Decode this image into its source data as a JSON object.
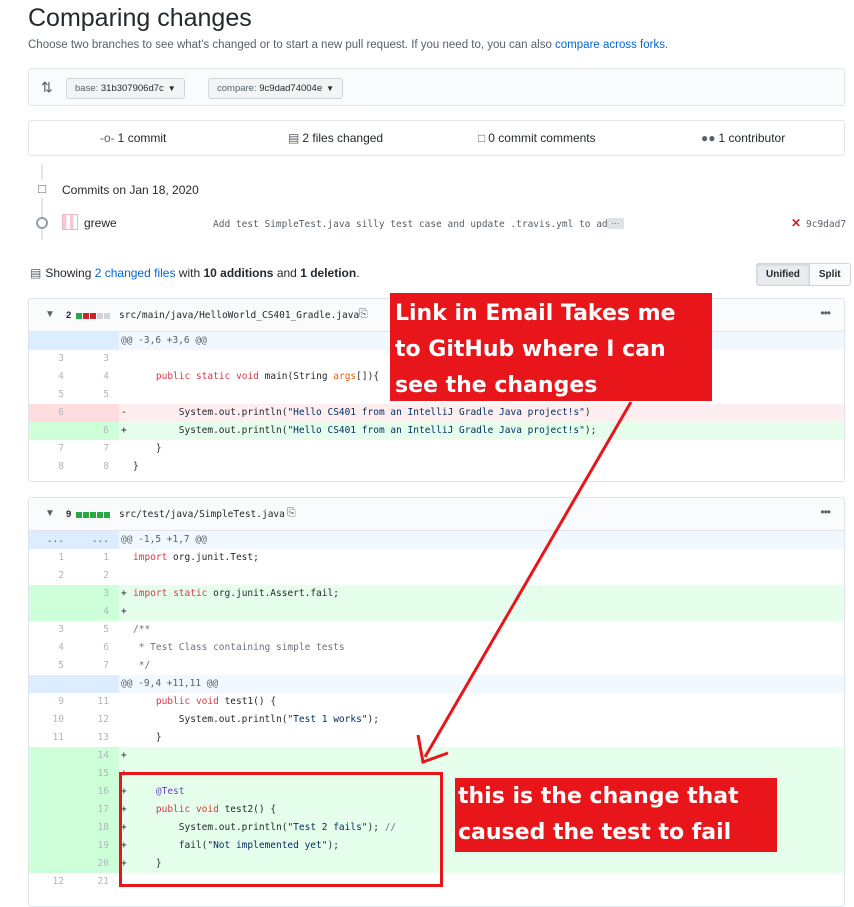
{
  "header": {
    "title": "Comparing changes",
    "subtitle_text": "Choose two branches to see what's changed or to start a new pull request. If you need to, you can also ",
    "subtitle_link": "compare across forks",
    "subtitle_end": "."
  },
  "range": {
    "base_label": "base:",
    "base_value": "31b307906d7c",
    "compare_label": "compare:",
    "compare_value": "9c9dad74004e"
  },
  "summary": {
    "commits": "1",
    "commits_label": "commit",
    "files": "2",
    "files_label": "files changed",
    "comments": "0",
    "comments_label": "commit comments",
    "contributors": "1",
    "contributors_label": "contributor"
  },
  "commits": {
    "date_heading": "Commits on Jan 18, 2020",
    "items": [
      {
        "author": "grewe",
        "message": "Add test SimpleTest.java silly test case and update .travis.yml to ad…",
        "ellipsis": "…",
        "sha": "9c9dad7",
        "status": "failed"
      }
    ]
  },
  "files_summary": {
    "prefix": "Showing ",
    "link": "2 changed files",
    "middle": " with ",
    "additions": "10 additions",
    "and": " and ",
    "deletions": "1 deletion",
    "suffix": "."
  },
  "view_toggle": {
    "unified": "Unified",
    "split": "Split"
  },
  "files": [
    {
      "count": "2",
      "path": "src/main/java/HelloWorld_CS401_Gradle.java",
      "hunk": "@@ -3,6 +3,6 @@",
      "lines": [
        {
          "old": "3",
          "new": "3",
          "sign": " ",
          "text": ""
        },
        {
          "old": "4",
          "new": "4",
          "sign": " ",
          "text": "    public static void main(String args[]){"
        },
        {
          "old": "5",
          "new": "5",
          "sign": " ",
          "text": ""
        },
        {
          "old": "6",
          "new": "",
          "sign": "-",
          "text": "        System.out.println(\"Hello CS401 from an IntelliJ Gradle Java project!s\")"
        },
        {
          "old": "",
          "new": "6",
          "sign": "+",
          "text": "        System.out.println(\"Hello CS401 from an IntelliJ Gradle Java project!s\");"
        },
        {
          "old": "7",
          "new": "7",
          "sign": " ",
          "text": "    }"
        },
        {
          "old": "8",
          "new": "8",
          "sign": " ",
          "text": "}"
        }
      ]
    },
    {
      "count": "9",
      "path": "src/test/java/SimpleTest.java",
      "hunk1": "@@ -1,5 +1,7 @@",
      "hunk1_num": "...",
      "hunk2": "@@ -9,4 +11,11 @@",
      "lines_a": [
        {
          "old": "1",
          "new": "1",
          "sign": " ",
          "text": "import org.junit.Test;"
        },
        {
          "old": "2",
          "new": "2",
          "sign": " ",
          "text": ""
        },
        {
          "old": "",
          "new": "3",
          "sign": "+",
          "text": "import static org.junit.Assert.fail;"
        },
        {
          "old": "",
          "new": "4",
          "sign": "+",
          "text": ""
        },
        {
          "old": "3",
          "new": "5",
          "sign": " ",
          "text": "/**"
        },
        {
          "old": "4",
          "new": "6",
          "sign": " ",
          "text": " * Test Class containing simple tests"
        },
        {
          "old": "5",
          "new": "7",
          "sign": " ",
          "text": " */"
        }
      ],
      "lines_b": [
        {
          "old": "9",
          "new": "11",
          "sign": " ",
          "text": "    public void test1() {"
        },
        {
          "old": "10",
          "new": "12",
          "sign": " ",
          "text": "        System.out.println(\"Test 1 works\");"
        },
        {
          "old": "11",
          "new": "13",
          "sign": " ",
          "text": "    }"
        },
        {
          "old": "",
          "new": "14",
          "sign": "+",
          "text": ""
        },
        {
          "old": "",
          "new": "15",
          "sign": "+",
          "text": ""
        },
        {
          "old": "",
          "new": "16",
          "sign": "+",
          "text": "    @Test"
        },
        {
          "old": "",
          "new": "17",
          "sign": "+",
          "text": "    public void test2() {"
        },
        {
          "old": "",
          "new": "18",
          "sign": "+",
          "text": "        System.out.println(\"Test 2 fails\"); //"
        },
        {
          "old": "",
          "new": "19",
          "sign": "+",
          "text": "        fail(\"Not implemented yet\");"
        },
        {
          "old": "",
          "new": "20",
          "sign": "+",
          "text": "    }"
        },
        {
          "old": "12",
          "new": "21",
          "sign": " ",
          "text": ""
        }
      ]
    }
  ],
  "annotations": {
    "callout_1": "Link in Email Takes me to GitHub where I can see the changes",
    "callout_2": "this is the change that caused the test to fail",
    "color": "#e8151a"
  },
  "colors": {
    "link": "#0366d6",
    "addition_bg": "#e6ffed",
    "deletion_bg": "#ffeef0",
    "hunk_bg": "#f1f8ff",
    "failure": "#cb2431"
  },
  "icons": [
    "compare-icon",
    "arrow-left-icon",
    "commit-icon",
    "file-diff-icon",
    "comment-icon",
    "people-icon",
    "repo-push-icon",
    "x-fail-icon",
    "copy-icon",
    "kebab-icon",
    "expand-icon",
    "chevron-down-icon"
  ]
}
